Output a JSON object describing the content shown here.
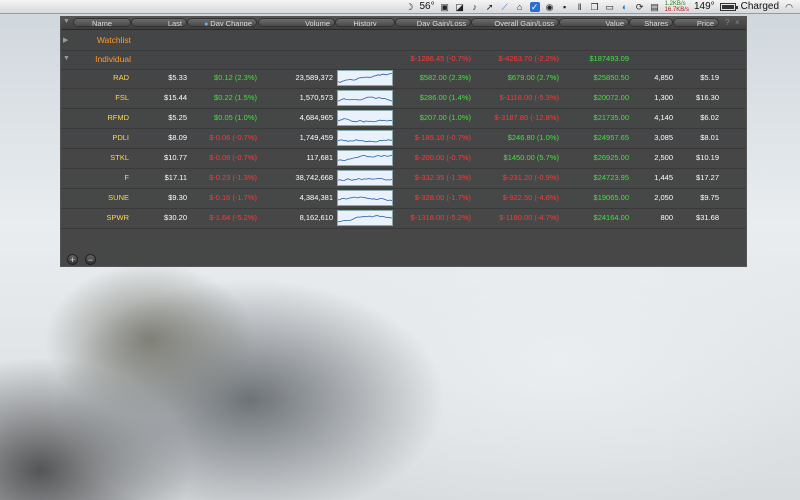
{
  "menubar": {
    "moon": "☽",
    "temperature": "56°",
    "net_up": "1.2KB/s",
    "net_down": "16.7KB/s",
    "cpu_temp": "149°",
    "battery_status": "Charged",
    "icons": [
      "moon-icon",
      "image-icon",
      "bookmark-icon",
      "music-icon",
      "cursor-icon",
      "chart-icon",
      "house-icon",
      "check-icon",
      "shield-icon",
      "camera-icon",
      "pause-icon",
      "copy-icon",
      "battery-small-icon",
      "display-icon",
      "sync-icon",
      "cube-icon",
      "wifi-icon"
    ]
  },
  "table": {
    "headers": {
      "name": "Name",
      "last": "Last",
      "day_change": "Day Change",
      "volume": "Volume",
      "history": "History",
      "day_gain": "Day Gain/Loss",
      "overall_gain": "Overall Gain/Loss",
      "value": "Value",
      "shares": "Shares",
      "price": "Price"
    },
    "groups": {
      "watchlist": "Watchlist",
      "individual": {
        "name": "Individual",
        "day_gain": "$-1286.45 (-0.7%)",
        "overall_gain": "$-4263.70 (-2.2%)",
        "value": "$187493.09"
      }
    },
    "rows": [
      {
        "name": "RAD",
        "last": "$5.33",
        "day_change": "$0.12 (2.3%)",
        "volume": "23,589,372",
        "day_gain": "$582.00 (2.3%)",
        "overall_gain": "$679.00 (2.7%)",
        "value": "$25850.50",
        "shares": "4,850",
        "price": "$5.19"
      },
      {
        "name": "FSL",
        "last": "$15.44",
        "day_change": "$0.22 (1.5%)",
        "volume": "1,570,573",
        "day_gain": "$286.00 (1.4%)",
        "overall_gain": "$-1118.00 (-5.3%)",
        "value": "$20072.00",
        "shares": "1,300",
        "price": "$16.30"
      },
      {
        "name": "RFMD",
        "last": "$5.25",
        "day_change": "$0.05 (1.0%)",
        "volume": "4,684,965",
        "day_gain": "$207.00 (1.0%)",
        "overall_gain": "$-3187.80 (-12.8%)",
        "value": "$21735.00",
        "shares": "4,140",
        "price": "$6.02"
      },
      {
        "name": "PDLI",
        "last": "$8.09",
        "day_change": "$-0.06 (-0.7%)",
        "volume": "1,749,459",
        "day_gain": "$-185.10 (-0.7%)",
        "overall_gain": "$246.80 (1.0%)",
        "value": "$24957.65",
        "shares": "3,085",
        "price": "$8.01"
      },
      {
        "name": "STKL",
        "last": "$10.77",
        "day_change": "$-0.08 (-0.7%)",
        "volume": "117,681",
        "day_gain": "$-200.00 (-0.7%)",
        "overall_gain": "$1450.00 (5.7%)",
        "value": "$26925.00",
        "shares": "2,500",
        "price": "$10.19"
      },
      {
        "name": "F",
        "last": "$17.11",
        "day_change": "$-0.23 (-1.3%)",
        "volume": "38,742,668",
        "day_gain": "$-332.35 (-1.3%)",
        "overall_gain": "$-231.20 (-0.9%)",
        "value": "$24723.95",
        "shares": "1,445",
        "price": "$17.27"
      },
      {
        "name": "SUNE",
        "last": "$9.30",
        "day_change": "$-0.16 (-1.7%)",
        "volume": "4,384,381",
        "day_gain": "$-328.00 (-1.7%)",
        "overall_gain": "$-922.50 (-4.6%)",
        "value": "$19065.00",
        "shares": "2,050",
        "price": "$9.75"
      },
      {
        "name": "SPWR",
        "last": "$30.20",
        "day_change": "$-1.64 (-5.2%)",
        "volume": "8,162,610",
        "day_gain": "$-1316.00 (-5.2%)",
        "overall_gain": "$-1180.00 (-4.7%)",
        "value": "$24164.00",
        "shares": "800",
        "price": "$31.68"
      }
    ],
    "add_label": "+",
    "remove_label": "−"
  },
  "colors": {
    "gain": "#3ce63c",
    "loss": "#ff3838",
    "symbol": "#ffd84a",
    "group": "#ff9a2a"
  }
}
